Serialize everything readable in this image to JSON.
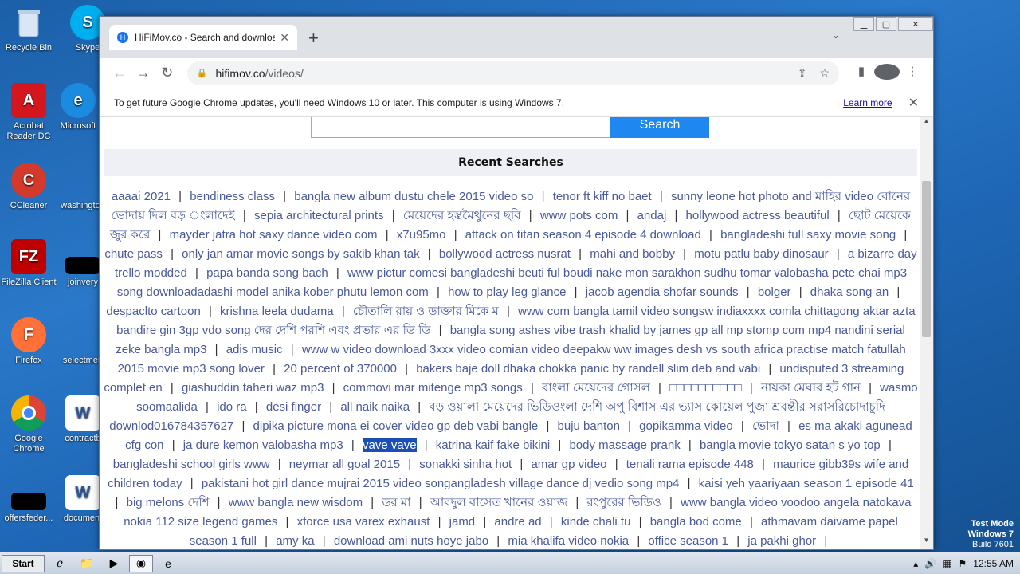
{
  "desktop": {
    "icons": [
      {
        "label": "Recycle Bin"
      },
      {
        "label": "Skype"
      },
      {
        "label": "Acrobat Reader DC"
      },
      {
        "label": "Microsoft"
      },
      {
        "label": "CCleaner"
      },
      {
        "label": "washington"
      },
      {
        "label": "FileZilla Client"
      },
      {
        "label": "joinvery"
      },
      {
        "label": "Firefox"
      },
      {
        "label": "selectmen"
      },
      {
        "label": "Google Chrome"
      },
      {
        "label": "contractb"
      },
      {
        "label": "offersfeder..."
      },
      {
        "label": "document"
      }
    ]
  },
  "browser": {
    "tab_title": "HiFiMov.co - Search and download a",
    "url_host": "hifimov.co",
    "url_path": "/videos/",
    "infobar_message": "To get future Google Chrome updates, you'll need Windows 10 or later. This computer is using Windows 7.",
    "infobar_link": "Learn more"
  },
  "page": {
    "search_button": "Search",
    "recent_heading": "Recent Searches",
    "recent_searches": [
      "aaaai 2021",
      "bendiness class",
      "bangla new album dustu chele 2015 video so",
      "tenor ft kiff no baet",
      "sunny leone hot photo and মাহির video বোনের ভোদায় দিল বড় ংলাদেই",
      "sepia architectural prints",
      "মেয়েদের হস্তমৈথুনের ছবি",
      "www pots com",
      "andaj",
      "hollywood actress beautiful",
      "ছোট মেয়েকে জুর করে",
      "mayder jatra hot saxy dance video com",
      "x7u95mo",
      "attack on titan season 4 episode 4 download",
      "bangladeshi full saxy movie song",
      "chute pass",
      "only jan amar movie songs by sakib khan tak",
      "bollywood actress nusrat",
      "mahi and bobby",
      "motu patlu baby dinosaur",
      "a bizarre day trello modded",
      "papa banda song bach",
      "www pictur comesi bangladeshi beuti ful boudi nake mon sarakhon sudhu tomar valobasha pete chai mp3 song downloadadashi model anika kober phutu lemon com",
      "how to play leg glance",
      "jacob agendia shofar sounds",
      "bolger",
      "dhaka song an",
      "despaclto cartoon",
      "krishna leela dudama",
      "চৌতালি রায় ও ডাক্তার মিকে ম",
      "www com bangla tamil video songsw indiaxxxx comla chittagong aktar azta bandire gin 3gp vdo song দের দেশি পরশি এবং প্রভার এর ডি ডি",
      "bangla song ashes vibe trash khalid by james gp all mp stomp com mp4 nandini serial zeke bangla mp3",
      "adis music",
      "www w video download 3xxx video comian video deepakw ww images desh vs south africa practise match fatullah 2015 movie mp3 song lover",
      "20 percent of 370000",
      "bakers baje doll dhaka chokka panic by randell slim deb and vabi",
      "undisputed 3 streaming complet en",
      "giashuddin taheri waz mp3",
      "commovi mar mitenge mp3 songs",
      "বাংলা মেয়েদের গোসল",
      "□□□□□□□□□□",
      "নায়কা মেঘার হট গান",
      "wasmo soomaalida",
      "ido ra",
      "desi finger",
      "all naik naika",
      "বড় ওয়ালা মেয়েদের ভিডিওংলা দেশি অপু বিশাস এর ভ্যাস কোয়েল পুজা শ্রবন্তীর সরাসরিচোদাচুদি downlod016784357627",
      "dipika picture mona ei cover video gp deb vabi bangle",
      "buju banton",
      "gopikamma video",
      "ভোদা",
      "es ma akaki agunead cfg con",
      "ja dure kemon valobasha mp3",
      "vave vave",
      "katrina kaif fake bikini",
      "body massage prank",
      "bangla movie tokyo satan s yo top",
      "bangladeshi school girls www",
      "neymar all goal 2015",
      "sonakki sinha hot",
      "amar gp video",
      "tenali rama episode 448",
      "maurice gibb39s wife and children today",
      "pakistani hot girl dance mujrai 2015 video songangladesh village dance dj vedio song mp4",
      "kaisi yeh yaariyaan season 1 episode 41",
      "big melons দেশি",
      "www bangla new wisdom",
      "ডর মা",
      "আবদুল বাসেত খানের ওয়াজ",
      "রংপুরের ভিডিও",
      "www bangla video voodoo angela natokava nokia 112 size legend games",
      "xforce usa varex exhaust",
      "jamd",
      "andre ad",
      "kinde chali tu",
      "bangla bod come",
      "athmavam daivame papel season 1 full",
      "amy ka",
      "download ami nuts hoye jabo",
      "mia khalifa video nokia",
      "office season 1",
      "ja pakhi ghor"
    ],
    "selected_search": "vave vave"
  },
  "taskbar": {
    "start_label": "Start",
    "clock": "12:55 AM"
  },
  "watermark": {
    "line1": "Test Mode",
    "line2": "Windows 7",
    "line3": "Build 7601"
  },
  "colors": {
    "accent": "#1e87f0",
    "link": "#4a5a9a",
    "selection": "#1b4fb5"
  }
}
